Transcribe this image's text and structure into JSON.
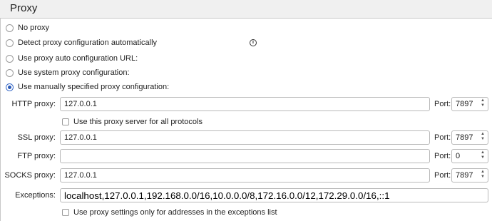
{
  "header": {
    "title": "Proxy"
  },
  "proxy_modes": [
    {
      "label": "No proxy",
      "checked": false
    },
    {
      "label": "Detect proxy configuration automatically",
      "checked": false
    },
    {
      "label": "Use proxy auto configuration URL:",
      "checked": false
    },
    {
      "label": "Use system proxy configuration:",
      "checked": false
    },
    {
      "label": "Use manually specified proxy configuration:",
      "checked": true
    }
  ],
  "info_icon": {
    "icon": "info-icon",
    "glyph": "i"
  },
  "manual": {
    "http": {
      "label": "HTTP proxy:",
      "value": "127.0.0.1",
      "port_label": "Port:",
      "port": "7897"
    },
    "use_for_all": {
      "label": "Use this proxy server for all protocols",
      "checked": false
    },
    "ssl": {
      "label": "SSL proxy:",
      "value": "127.0.0.1",
      "port_label": "Port:",
      "port": "7897"
    },
    "ftp": {
      "label": "FTP proxy:",
      "value": "",
      "port_label": "Port:",
      "port": "0"
    },
    "socks": {
      "label": "SOCKS proxy:",
      "value": "127.0.0.1",
      "port_label": "Port:",
      "port": "7897"
    },
    "exceptions": {
      "label": "Exceptions:",
      "value": "localhost,127.0.0.1,192.168.0.0/16,10.0.0.0/8,172.16.0.0/12,172.29.0.0/16,::1"
    },
    "exceptions_only": {
      "label": "Use proxy settings only for addresses in the exceptions list",
      "checked": false
    }
  },
  "colors": {
    "accent": "#2a5ab8",
    "border": "#b9b9b9",
    "header_bg": "#f0f0f0"
  }
}
